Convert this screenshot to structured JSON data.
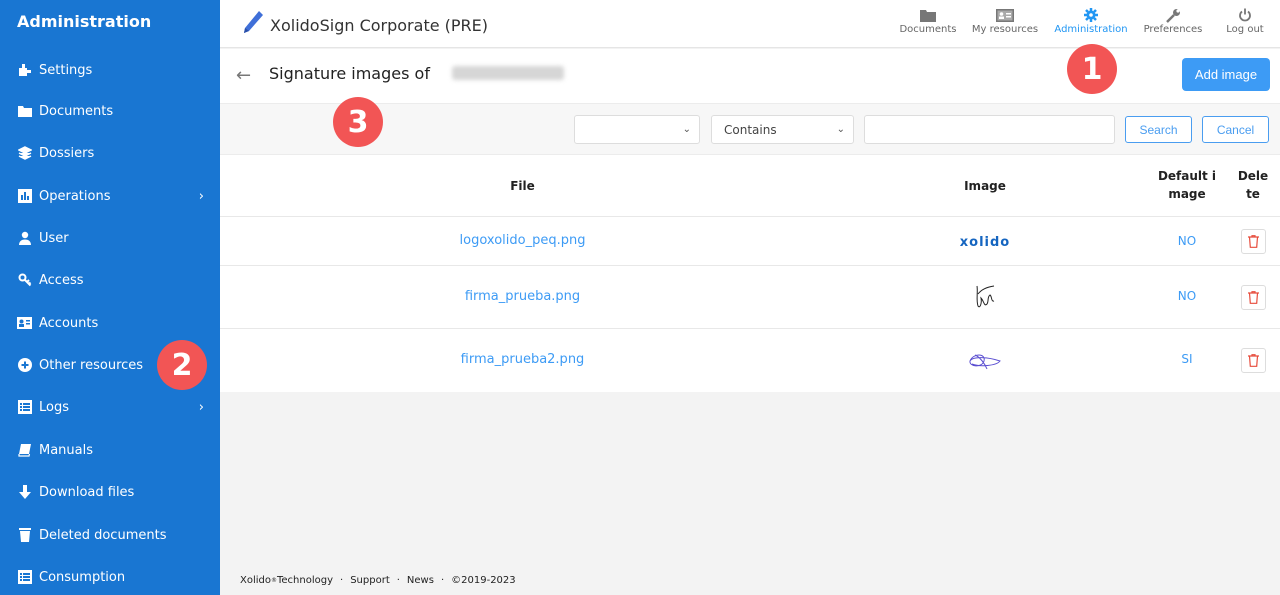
{
  "sidebar": {
    "title": "Administration",
    "items": [
      {
        "label": "Settings",
        "icon": "puzzle-icon",
        "has_chevron": false
      },
      {
        "label": "Documents",
        "icon": "folder-icon",
        "has_chevron": false
      },
      {
        "label": "Dossiers",
        "icon": "layers-icon",
        "has_chevron": false
      },
      {
        "label": "Operations",
        "icon": "bar-chart-icon",
        "has_chevron": true
      },
      {
        "label": "User",
        "icon": "user-icon",
        "has_chevron": false
      },
      {
        "label": "Access",
        "icon": "key-icon",
        "has_chevron": false
      },
      {
        "label": "Accounts",
        "icon": "id-card-icon",
        "has_chevron": false
      },
      {
        "label": "Other resources",
        "icon": "plus-circle-icon",
        "has_chevron": false
      },
      {
        "label": "Logs",
        "icon": "list-icon",
        "has_chevron": true
      },
      {
        "label": "Manuals",
        "icon": "book-icon",
        "has_chevron": false
      },
      {
        "label": "Download files",
        "icon": "download-arrow-icon",
        "has_chevron": false
      },
      {
        "label": "Deleted documents",
        "icon": "trash-icon",
        "has_chevron": false
      },
      {
        "label": "Consumption",
        "icon": "list-icon",
        "has_chevron": false
      }
    ]
  },
  "header": {
    "app_title": "XolidoSign Corporate (PRE)",
    "nav": [
      {
        "label": "Documents",
        "icon": "folder-icon",
        "active": false
      },
      {
        "label": "My resources",
        "icon": "id-card-icon",
        "active": false
      },
      {
        "label": "Administration",
        "icon": "gear-icon",
        "active": true
      },
      {
        "label": "Preferences",
        "icon": "wrench-icon",
        "active": false
      },
      {
        "label": "Log out",
        "icon": "power-icon",
        "active": false
      }
    ]
  },
  "page": {
    "title": "Signature images of",
    "add_button": "Add image"
  },
  "filter": {
    "field_select": "",
    "operator_select": "Contains",
    "search_value": "",
    "search_button": "Search",
    "cancel_button": "Cancel"
  },
  "table": {
    "headers": {
      "file": "File",
      "image": "Image",
      "default_line1": "Default i",
      "default_line2": "mage",
      "delete_line1": "Dele",
      "delete_line2": "te"
    },
    "rows": [
      {
        "file": "logoxolido_peq.png",
        "image": "xolido",
        "default": "NO"
      },
      {
        "file": "firma_prueba.png",
        "image": "signature-black",
        "default": "NO"
      },
      {
        "file": "firma_prueba2.png",
        "image": "signature-purple",
        "default": "SI"
      }
    ]
  },
  "footer": {
    "company": "Xolido",
    "reg": "®",
    "company_suffix": " Technology",
    "support": "Support",
    "news": "News",
    "copyright": "©2019-2023",
    "separator": "·"
  },
  "annotations": [
    "1",
    "2",
    "3"
  ],
  "colors": {
    "sidebar_bg": "#1976d2",
    "accent": "#3d9bf5",
    "badge": "#f25555",
    "delete": "#e74c3c"
  }
}
